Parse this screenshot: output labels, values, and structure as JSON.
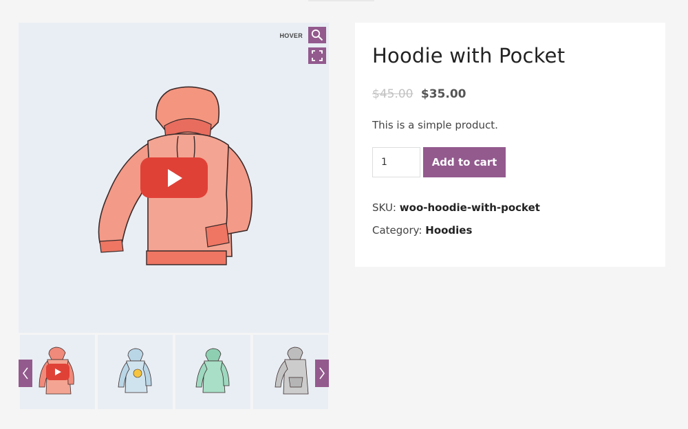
{
  "gallery": {
    "hover_label": "HOVER",
    "zoom_icon": "search-icon",
    "fullscreen_icon": "fullscreen-icon",
    "play_icon": "play-icon",
    "thumbnails": [
      {
        "color": "#f08a7a",
        "has_video": true
      },
      {
        "color": "#b9d6e6",
        "has_video": false
      },
      {
        "color": "#9ed8c0",
        "has_video": false
      },
      {
        "color": "#c4c4c4",
        "has_video": false
      }
    ],
    "prev_icon": "chevron-left-icon",
    "next_icon": "chevron-right-icon"
  },
  "product": {
    "title": "Hoodie with Pocket",
    "regular_price": "$45.00",
    "sale_price": "$35.00",
    "description": "This is a simple product.",
    "quantity": "1",
    "add_to_cart_label": "Add to cart",
    "sku_label": "SKU:",
    "sku": "woo-hoodie-with-pocket",
    "category_label": "Category:",
    "category": "Hoodies"
  },
  "colors": {
    "accent": "#935a8e",
    "youtube_red": "#e04137",
    "hoodie_main": "#f08a7a"
  }
}
